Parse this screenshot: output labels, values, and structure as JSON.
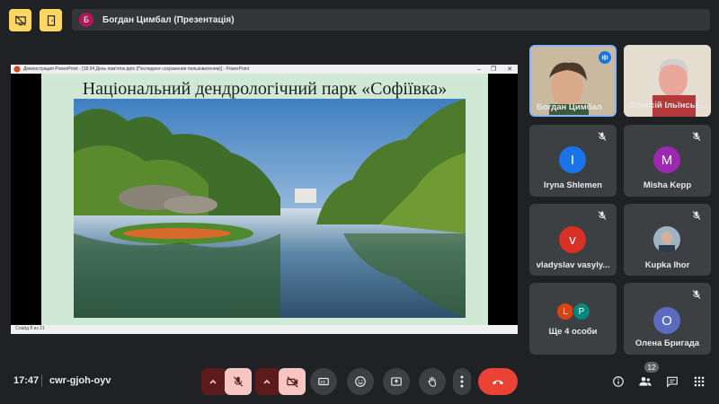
{
  "presenter": {
    "avatar_letter": "Б",
    "label": "Богдан Цимбал (Презентація)"
  },
  "window": {
    "title": "Демонстрация PowerPoint - [18.04 День пам'яток.pptx (Последнее сохранение пользователем)] - PowerPoint",
    "status": "Слайд 8 из 21"
  },
  "slide": {
    "title": "Національний дендрологічний парк «Софіївка»"
  },
  "participants": {
    "video": [
      {
        "name": "Богдан Цимбал"
      },
      {
        "name": "Олексій Ільїнськ..."
      }
    ],
    "tiles": [
      {
        "initial": "I",
        "name": "Iryna Shlemen",
        "color": "#1a73e8"
      },
      {
        "initial": "M",
        "name": "Misha Kepp",
        "color": "#9c27b0"
      },
      {
        "initial": "v",
        "name": "vladyslav vasyly...",
        "color": "#d93025"
      },
      {
        "initial": "",
        "name": "Kupka Ihor",
        "color": "#8d9aa5"
      },
      {
        "initial": "O",
        "name": "Олена Бригада",
        "color": "#5c6bc0"
      }
    ],
    "more": {
      "label": "Ще 4 особи",
      "avatars": [
        {
          "initial": "L",
          "color": "#d84315"
        },
        {
          "initial": "P",
          "color": "#00897b"
        }
      ]
    }
  },
  "bottom": {
    "time": "17:47",
    "meeting_code": "cwr-gjoh-oyv",
    "people_count": "12"
  },
  "colors": {
    "background": "#202124",
    "tile": "#3c4043",
    "accent_yellow": "#fdd663",
    "hangup": "#ea4335"
  }
}
